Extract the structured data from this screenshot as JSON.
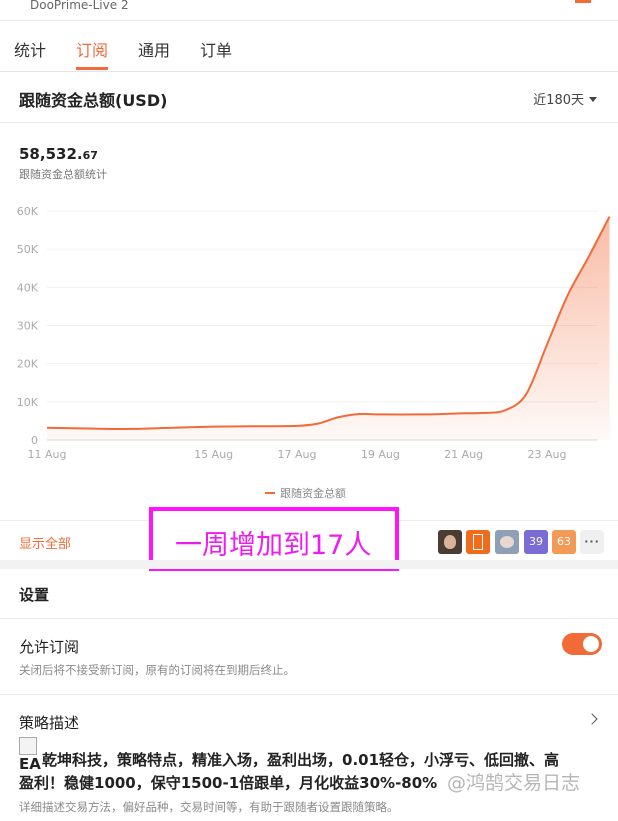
{
  "account": {
    "name": "DooPrime-Live 2"
  },
  "tabs": [
    {
      "label": "统计",
      "active": false
    },
    {
      "label": "订阅",
      "active": true
    },
    {
      "label": "通用",
      "active": false
    },
    {
      "label": "订单",
      "active": false
    }
  ],
  "card": {
    "title": "跟随资金总额(USD)",
    "period": "近180天",
    "value_int": "58,532.",
    "value_dec": "67",
    "value_caption": "跟随资金总额统计"
  },
  "chart_data": {
    "type": "area",
    "series": [
      {
        "name": "跟随资金总额",
        "color": "#f26a38",
        "points": [
          [
            "11 Aug",
            3200
          ],
          [
            "12 Aug",
            3000
          ],
          [
            "13 Aug",
            2900
          ],
          [
            "14 Aug",
            3200
          ],
          [
            "15 Aug",
            3500
          ],
          [
            "16 Aug",
            3600
          ],
          [
            "17 Aug",
            3700
          ],
          [
            "17.5 Aug",
            4300
          ],
          [
            "18 Aug",
            6000
          ],
          [
            "18.5 Aug",
            6800
          ],
          [
            "19 Aug",
            6700
          ],
          [
            "20 Aug",
            6700
          ],
          [
            "20.5 Aug",
            6800
          ],
          [
            "21 Aug",
            7000
          ],
          [
            "21.5 Aug",
            7100
          ],
          [
            "22 Aug",
            7800
          ],
          [
            "22.5 Aug",
            12000
          ],
          [
            "23 Aug",
            25000
          ],
          [
            "23.5 Aug",
            38000
          ],
          [
            "24 Aug",
            48000
          ],
          [
            "24.5 Aug",
            58532
          ]
        ]
      }
    ],
    "x_ticks": [
      "11 Aug",
      "15 Aug",
      "17 Aug",
      "19 Aug",
      "21 Aug",
      "23 Aug"
    ],
    "y_ticks": [
      "0",
      "10K",
      "20K",
      "30K",
      "40K",
      "50K",
      "60K"
    ],
    "ylim": [
      0,
      60000
    ],
    "legend": "跟随资金总额",
    "legend_position": "bottom-center",
    "grid": true
  },
  "footer": {
    "show_all": "显示全部",
    "avatar_counts": [
      "39",
      "63"
    ],
    "more": "···"
  },
  "annotation": {
    "text": "一周增加到17人"
  },
  "settings": {
    "title": "设置",
    "allow_subscribe_label": "允许订阅",
    "allow_subscribe_desc": "关闭后将不接受新订阅，原有的订阅将在到期后终止。",
    "allow_subscribe_on": true
  },
  "strategy": {
    "label": "策略描述",
    "image_alt": "EA",
    "text_line1": "乾坤科技，策略特点，精准入场，盈利出场，0.01轻仓，小浮亏、低回撤、高",
    "text_line2": "盈利！稳健1000，保守1500-1倍跟单，月化收益30%-80%",
    "watermark": "@鸿鹄交易日志",
    "hint": "详细描述交易方法，偏好品种，交易时间等，有助于跟随者设置跟随策略。"
  },
  "colors": {
    "accent": "#f26a38",
    "annotation": "#ff14ff"
  }
}
